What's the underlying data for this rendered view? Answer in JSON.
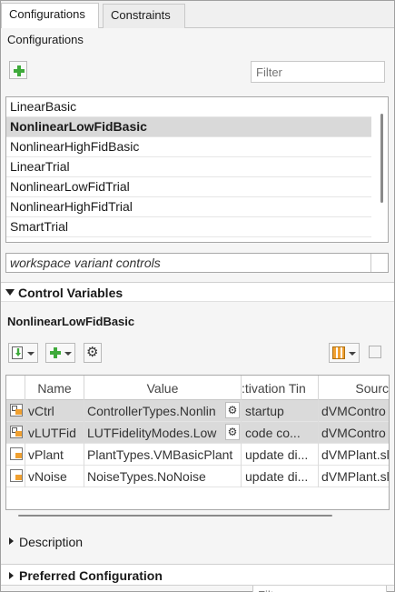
{
  "tabs": [
    {
      "label": "Configurations",
      "active": true
    },
    {
      "label": "Constraints",
      "active": false
    }
  ],
  "configurations": {
    "section_label": "Configurations",
    "filter_placeholder": "Filter",
    "items": [
      {
        "name": "LinearBasic",
        "selected": false
      },
      {
        "name": "NonlinearLowFidBasic",
        "selected": true
      },
      {
        "name": "NonlinearHighFidBasic",
        "selected": false
      },
      {
        "name": "LinearTrial",
        "selected": false
      },
      {
        "name": "NonlinearLowFidTrial",
        "selected": false
      },
      {
        "name": "NonlinearHighFidTrial",
        "selected": false
      },
      {
        "name": "SmartTrial",
        "selected": false
      }
    ],
    "variant_controls": "workspace variant controls"
  },
  "control_variables": {
    "header": "Control Variables",
    "config_name": "NonlinearLowFidBasic",
    "filter_placeholder": "Filter",
    "columns": [
      "Name",
      "Value",
      ":tivation Tin",
      "Sourc"
    ],
    "rows": [
      {
        "name": "vCtrl",
        "value": "ControllerTypes.Nonlin",
        "activation": "startup",
        "source": "dVMContro",
        "highlighted": true,
        "gear": true
      },
      {
        "name": "vLUTFid",
        "value": "LUTFidelityModes.Low",
        "activation": "code co...",
        "source": "dVMContro",
        "highlighted": true,
        "gear": true
      },
      {
        "name": "vPlant",
        "value": "PlantTypes.VMBasicPlant",
        "activation": "update di...",
        "source": "dVMPlant.sl",
        "highlighted": false,
        "gear": false
      },
      {
        "name": "vNoise",
        "value": "NoiseTypes.NoNoise",
        "activation": "update di...",
        "source": "dVMPlant.sl",
        "highlighted": false,
        "gear": false
      }
    ]
  },
  "description": {
    "label": "Description"
  },
  "preferred": {
    "label": "Preferred Configuration"
  },
  "colors": {
    "selection": "#d9d9d9",
    "accent_green": "#3eaa3a",
    "panel_bg": "#f5f5f5"
  }
}
